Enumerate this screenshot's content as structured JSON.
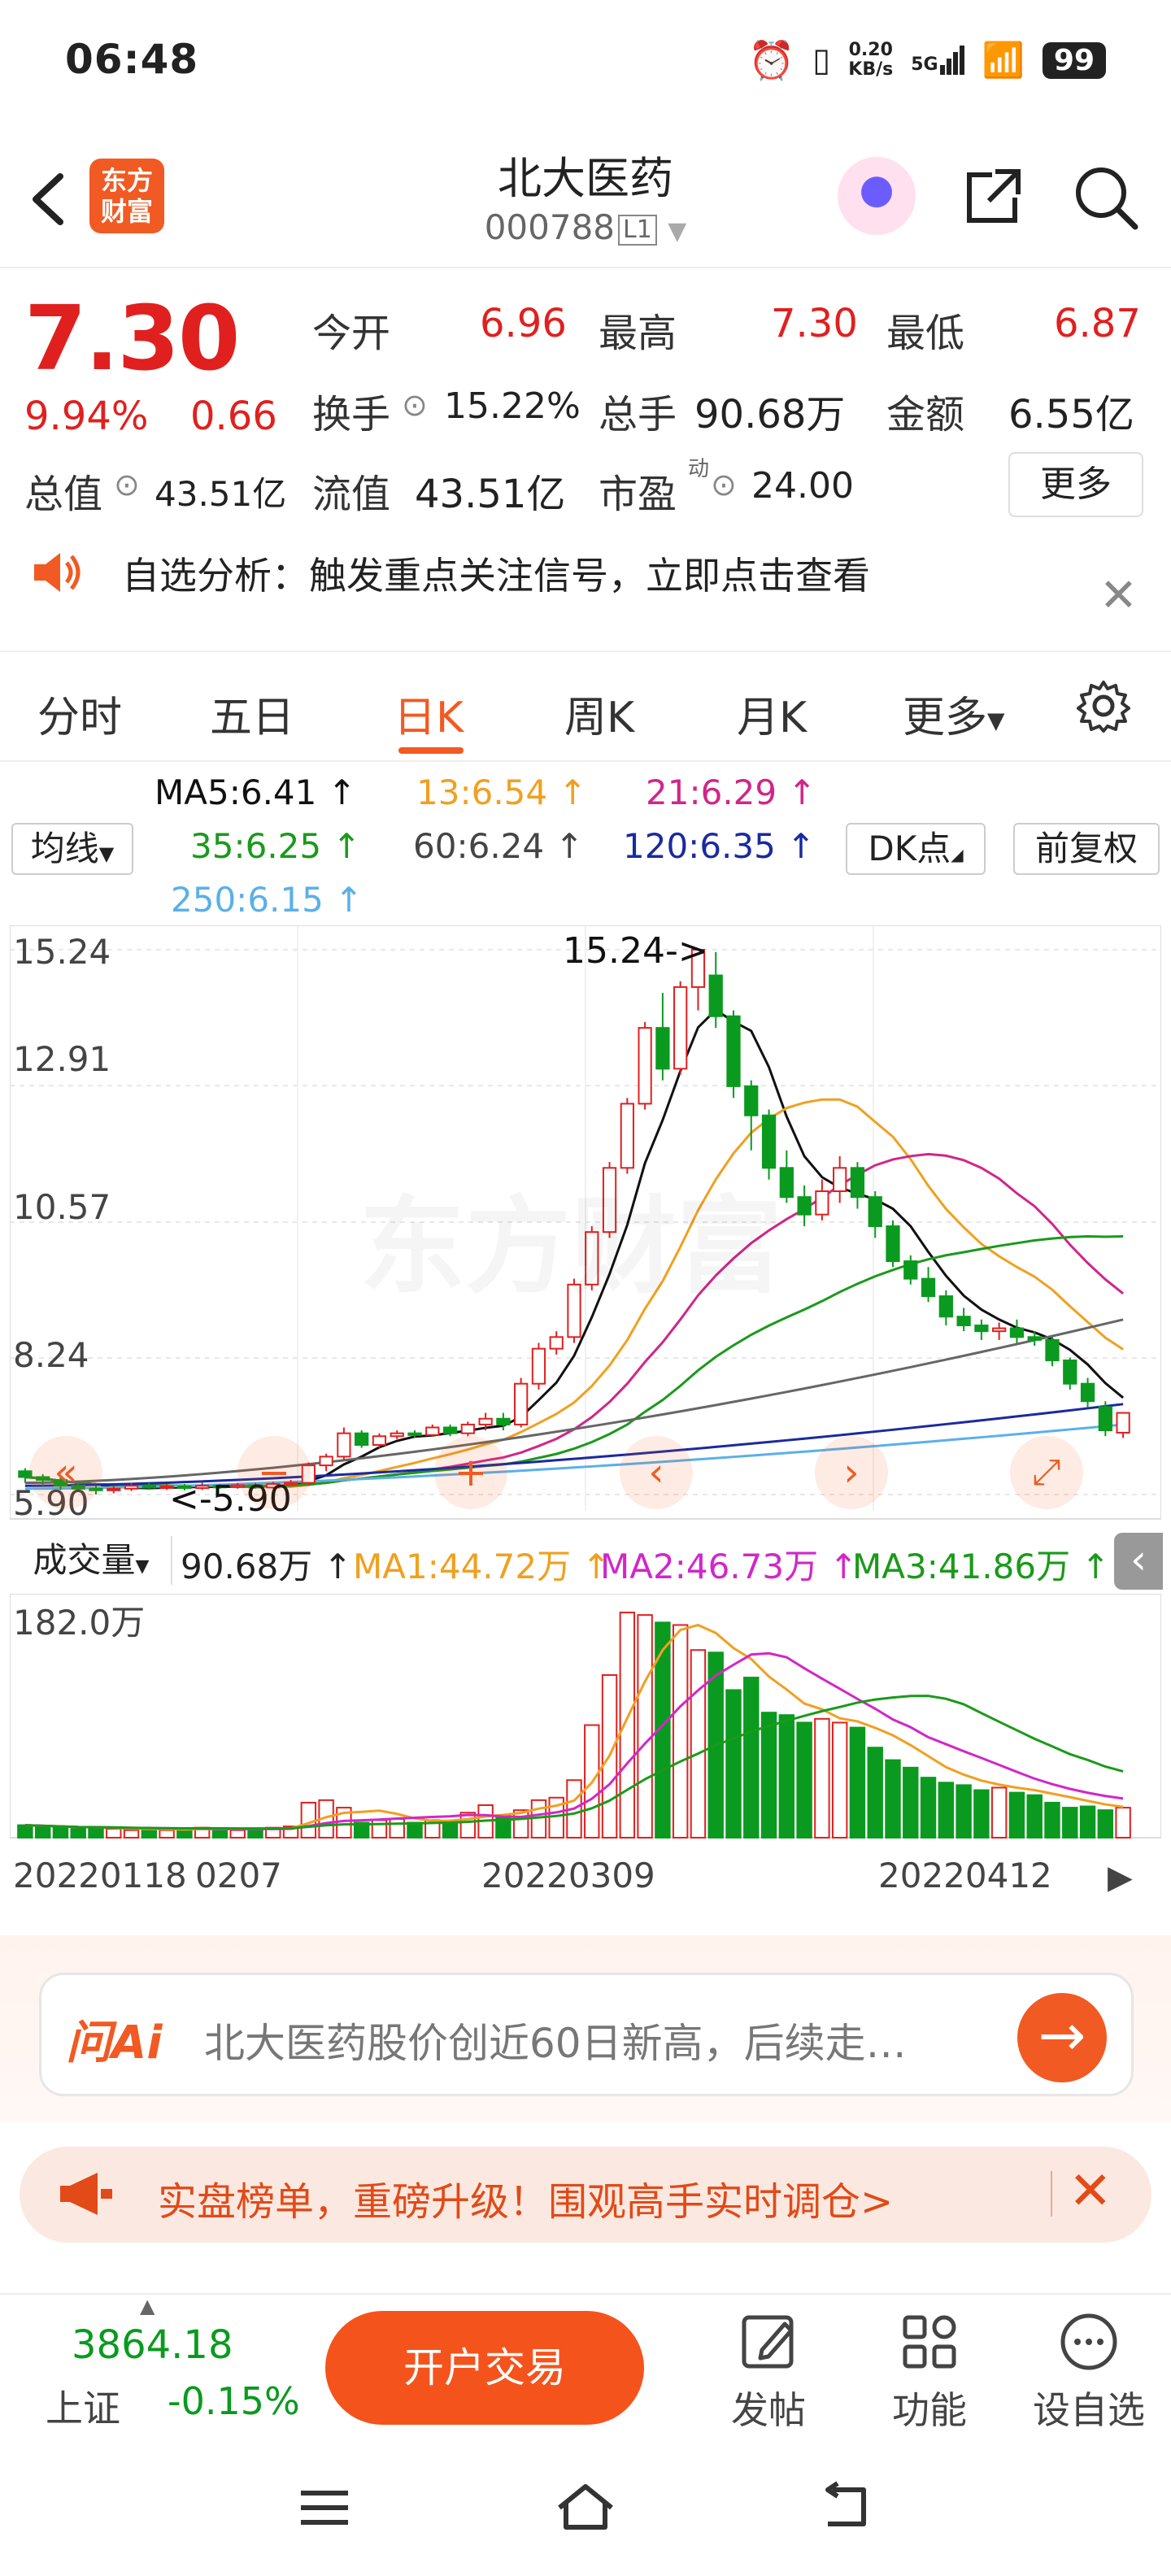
{
  "status": {
    "time": "06:48",
    "net_speed": "0.20\nKB/s",
    "net_speed_top": "0.20",
    "net_speed_bottom": "KB/s",
    "signal": "5G",
    "battery": "99"
  },
  "header": {
    "logo_line1": "东方",
    "logo_line2": "财富",
    "title": "北大医药",
    "code": "000788",
    "level": "L1"
  },
  "quote": {
    "price": "7.30",
    "change_pct": "9.94%",
    "change": "0.66",
    "open_label": "今开",
    "open": "6.96",
    "high_label": "最高",
    "high": "7.30",
    "low_label": "最低",
    "low": "6.87",
    "turnover_label": "换手",
    "turnover": "15.22%",
    "volume_label": "总手",
    "volume": "90.68万",
    "amount_label": "金额",
    "amount": "6.55亿",
    "mktcap_label": "总值",
    "mktcap": "43.51亿",
    "float_label": "流值",
    "float": "43.51亿",
    "pe_label": "市盈",
    "pe_sup": "动",
    "pe": "24.00",
    "more": "更多"
  },
  "notice": {
    "text": "自选分析：触发重点关注信号，立即点击查看"
  },
  "tabs": [
    {
      "label": "分时"
    },
    {
      "label": "五日"
    },
    {
      "label": "日K"
    },
    {
      "label": "周K"
    },
    {
      "label": "月K"
    },
    {
      "label": "更多"
    }
  ],
  "ma": {
    "select": "均线",
    "ma5": "MA5:6.41",
    "ma13": "13:6.54",
    "ma21": "21:6.29",
    "ma35": "35:6.25",
    "ma60": "60:6.24",
    "ma120": "120:6.35",
    "ma250": "250:6.15",
    "dk": "DK点",
    "adjust": "前复权"
  },
  "chart": {
    "y_top": "15.24",
    "y2": "12.91",
    "y3": "10.57",
    "y4": "8.24",
    "y_bottom": "5.90",
    "hi_annot": "15.24->",
    "lo_annot": "<-5.90",
    "watermark": "东方财富"
  },
  "volume": {
    "select": "成交量",
    "vol": "90.68万",
    "ma1": "MA1:44.72万",
    "ma2": "MA2:46.73万",
    "ma3": "MA3:41.86万",
    "y_top": "182.0万"
  },
  "dates": [
    "20220118",
    "0207",
    "20220309",
    "20220412"
  ],
  "ai": {
    "logo": "问Ai",
    "text": "北大医药股价创近60日新高，后续走…"
  },
  "promo": {
    "text": "实盘榜单，重磅升级！围观高手实时调仓>"
  },
  "toolbar": {
    "index_value": "3864.18",
    "index_name": "上证",
    "index_change": "-0.15%",
    "trade": "开户交易",
    "post": "发帖",
    "func": "功能",
    "watch": "设自选"
  },
  "colors": {
    "accent": "#f15a22",
    "up": "#e0201f",
    "down": "#0a9a1f",
    "ma5": "#111111",
    "ma13": "#f0a020",
    "ma21": "#d0268a",
    "ma35": "#1a9a1a",
    "ma60": "#666666",
    "ma120": "#1a2aa0",
    "ma250": "#5ab0e8"
  },
  "chart_data": {
    "type": "candlestick",
    "ylim": [
      5.9,
      15.24
    ],
    "candles": [
      [
        6.3,
        6.2,
        6.35,
        6.1
      ],
      [
        6.2,
        6.15,
        6.25,
        6.05
      ],
      [
        6.15,
        6.05,
        6.2,
        5.98
      ],
      [
        6.05,
        6.0,
        6.1,
        5.95
      ],
      [
        6.0,
        5.98,
        6.05,
        5.9
      ],
      [
        5.98,
        6.0,
        6.05,
        5.92
      ],
      [
        6.0,
        6.05,
        6.1,
        5.96
      ],
      [
        6.05,
        6.02,
        6.1,
        5.98
      ],
      [
        6.02,
        6.04,
        6.08,
        5.98
      ],
      [
        6.04,
        6.01,
        6.08,
        5.97
      ],
      [
        6.01,
        6.05,
        6.1,
        5.98
      ],
      [
        6.05,
        6.03,
        6.08,
        6.0
      ],
      [
        6.03,
        6.06,
        6.1,
        6.0
      ],
      [
        6.06,
        6.02,
        6.1,
        6.0
      ],
      [
        6.02,
        6.08,
        6.12,
        6.0
      ],
      [
        6.08,
        6.1,
        6.15,
        6.04
      ],
      [
        6.1,
        6.4,
        6.45,
        6.05
      ],
      [
        6.4,
        6.55,
        6.6,
        6.3
      ],
      [
        6.55,
        6.95,
        7.05,
        6.5
      ],
      [
        6.95,
        6.75,
        7.0,
        6.7
      ],
      [
        6.75,
        6.9,
        6.95,
        6.7
      ],
      [
        6.9,
        6.95,
        7.0,
        6.85
      ],
      [
        6.95,
        6.92,
        7.0,
        6.88
      ],
      [
        6.92,
        7.05,
        7.1,
        6.9
      ],
      [
        7.05,
        6.95,
        7.1,
        6.9
      ],
      [
        6.95,
        7.1,
        7.15,
        6.9
      ],
      [
        7.1,
        7.2,
        7.3,
        7.0
      ],
      [
        7.2,
        7.1,
        7.3,
        7.0
      ],
      [
        7.1,
        7.8,
        7.9,
        7.05
      ],
      [
        7.8,
        8.4,
        8.5,
        7.7
      ],
      [
        8.4,
        8.6,
        8.7,
        8.3
      ],
      [
        8.6,
        9.5,
        9.6,
        8.5
      ],
      [
        9.5,
        10.4,
        10.5,
        9.4
      ],
      [
        10.4,
        11.5,
        11.6,
        10.3
      ],
      [
        11.5,
        12.6,
        12.7,
        11.4
      ],
      [
        12.6,
        13.9,
        14.0,
        12.5
      ],
      [
        13.9,
        13.2,
        14.5,
        13.0
      ],
      [
        13.2,
        14.6,
        14.7,
        13.1
      ],
      [
        14.6,
        15.24,
        15.24,
        14.2
      ],
      [
        14.8,
        14.1,
        15.2,
        13.9
      ],
      [
        14.1,
        12.9,
        14.2,
        12.7
      ],
      [
        12.9,
        12.4,
        13.0,
        11.8
      ],
      [
        12.4,
        11.5,
        12.5,
        11.3
      ],
      [
        11.5,
        11.0,
        11.8,
        10.9
      ],
      [
        11.0,
        10.7,
        11.2,
        10.5
      ],
      [
        10.7,
        11.1,
        11.3,
        10.6
      ],
      [
        11.1,
        11.5,
        11.7,
        10.9
      ],
      [
        11.5,
        11.0,
        11.6,
        10.8
      ],
      [
        11.0,
        10.5,
        11.1,
        10.3
      ],
      [
        10.5,
        9.9,
        10.6,
        9.8
      ],
      [
        9.9,
        9.6,
        10.0,
        9.5
      ],
      [
        9.6,
        9.3,
        9.8,
        9.2
      ],
      [
        9.3,
        8.95,
        9.4,
        8.8
      ],
      [
        8.95,
        8.8,
        9.1,
        8.7
      ],
      [
        8.8,
        8.7,
        8.9,
        8.55
      ],
      [
        8.7,
        8.75,
        8.85,
        8.55
      ],
      [
        8.75,
        8.6,
        8.9,
        8.5
      ],
      [
        8.6,
        8.55,
        8.7,
        8.45
      ],
      [
        8.55,
        8.2,
        8.6,
        8.1
      ],
      [
        8.2,
        7.8,
        8.25,
        7.7
      ],
      [
        7.8,
        7.5,
        7.9,
        7.4
      ],
      [
        7.4,
        7.0,
        7.5,
        6.9
      ],
      [
        6.96,
        7.3,
        7.3,
        6.87
      ]
    ],
    "volume": [
      10,
      9,
      8,
      7,
      8,
      7,
      6,
      7,
      6,
      7,
      8,
      7,
      6,
      7,
      8,
      9,
      28,
      30,
      24,
      12,
      14,
      15,
      12,
      14,
      13,
      20,
      26,
      18,
      22,
      30,
      32,
      46,
      90,
      130,
      180,
      178,
      172,
      170,
      150,
      148,
      118,
      128,
      100,
      98,
      92,
      95,
      92,
      88,
      72,
      62,
      56,
      48,
      44,
      42,
      38,
      40,
      36,
      34,
      28,
      24,
      25,
      22,
      24
    ],
    "volume_unit": "万",
    "last_volume": "90.68万"
  }
}
